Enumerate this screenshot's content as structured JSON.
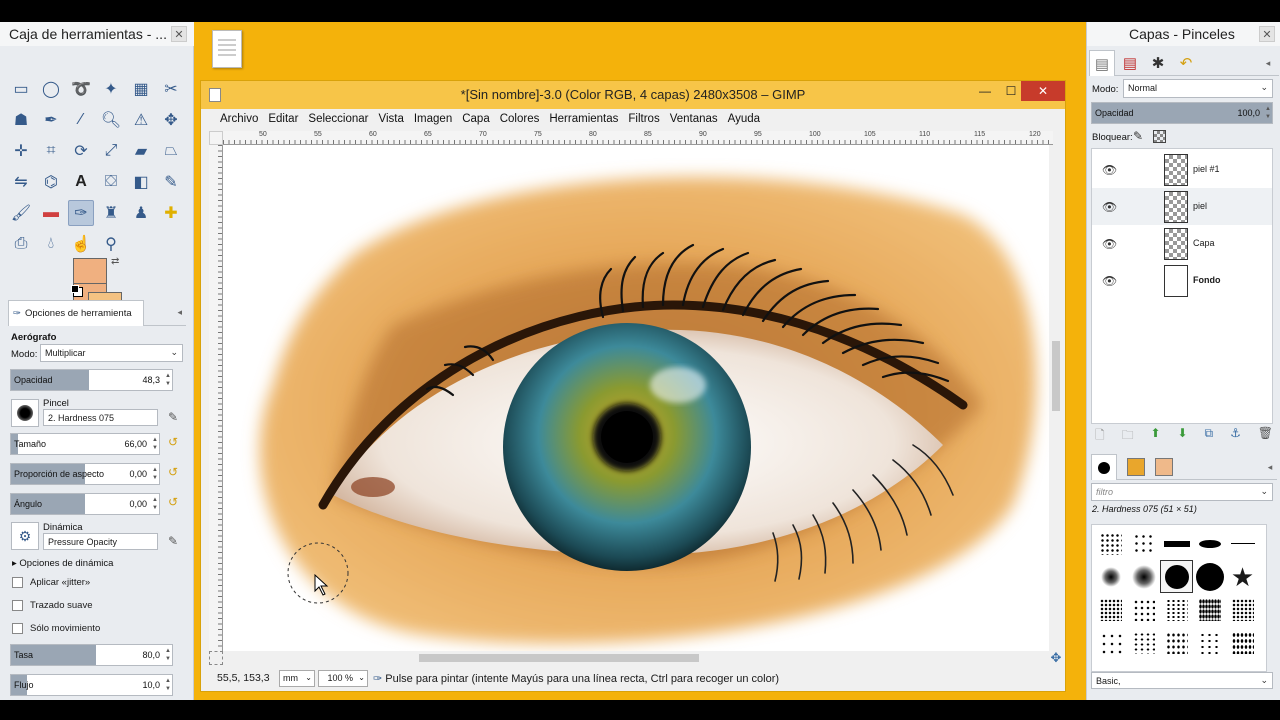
{
  "toolbox": {
    "title": "Caja de herramientas - ...",
    "tool_options_tab": "Opciones de herramienta",
    "tool_name": "Aerógrafo",
    "mode_label": "Modo:",
    "mode_value": "Multiplicar",
    "opacity_label": "Opacidad",
    "opacity_value": "48,3",
    "opacity_fraction": 0.483,
    "brush_label": "Pincel",
    "brush_value": "2. Hardness 075",
    "size_label": "Tamaño",
    "size_value": "66,00",
    "aspect_label": "Proporción de aspecto",
    "aspect_value": "0,00",
    "angle_label": "Ángulo",
    "angle_value": "0,00",
    "dynamics_label": "Dinámica",
    "dynamics_value": "Pressure Opacity",
    "dynamics_options": "Opciones de dinámica",
    "jitter_label": "Aplicar «jitter»",
    "smooth_label": "Trazado suave",
    "motion_label": "Sólo movimiento",
    "rate_label": "Tasa",
    "rate_value": "80,0",
    "flow_label": "Flujo",
    "flow_value": "10,0",
    "fg_color": "#f0b080",
    "bg_color": "#f4c282"
  },
  "gimp": {
    "title": "*[Sin nombre]-3.0 (Color RGB, 4 capas) 2480x3508 – GIMP",
    "menus": [
      "Archivo",
      "Editar",
      "Seleccionar",
      "Vista",
      "Imagen",
      "Capa",
      "Colores",
      "Herramientas",
      "Filtros",
      "Ventanas",
      "Ayuda"
    ],
    "ruler_labels": [
      "50",
      "55",
      "60",
      "65",
      "70",
      "75",
      "80",
      "85",
      "90",
      "95",
      "100",
      "105",
      "110",
      "115",
      "120"
    ],
    "coords": "55,5, 153,3",
    "unit": "mm",
    "zoom": "100 %",
    "status_message": "Pulse para pintar (intente Mayús para una línea recta, Ctrl para recoger un color)"
  },
  "layers": {
    "title": "Capas - Pinceles",
    "mode_label": "Modo:",
    "mode_value": "Normal",
    "opacity_label": "Opacidad",
    "opacity_value": "100,0",
    "lock_label": "Bloquear:",
    "items": [
      {
        "name": "piel #1"
      },
      {
        "name": "piel"
      },
      {
        "name": "Capa"
      },
      {
        "name": "Fondo"
      }
    ],
    "filter_placeholder": "filtro",
    "brush_name": "2. Hardness 075 (51 × 51)",
    "brush_set": "Basic,"
  }
}
